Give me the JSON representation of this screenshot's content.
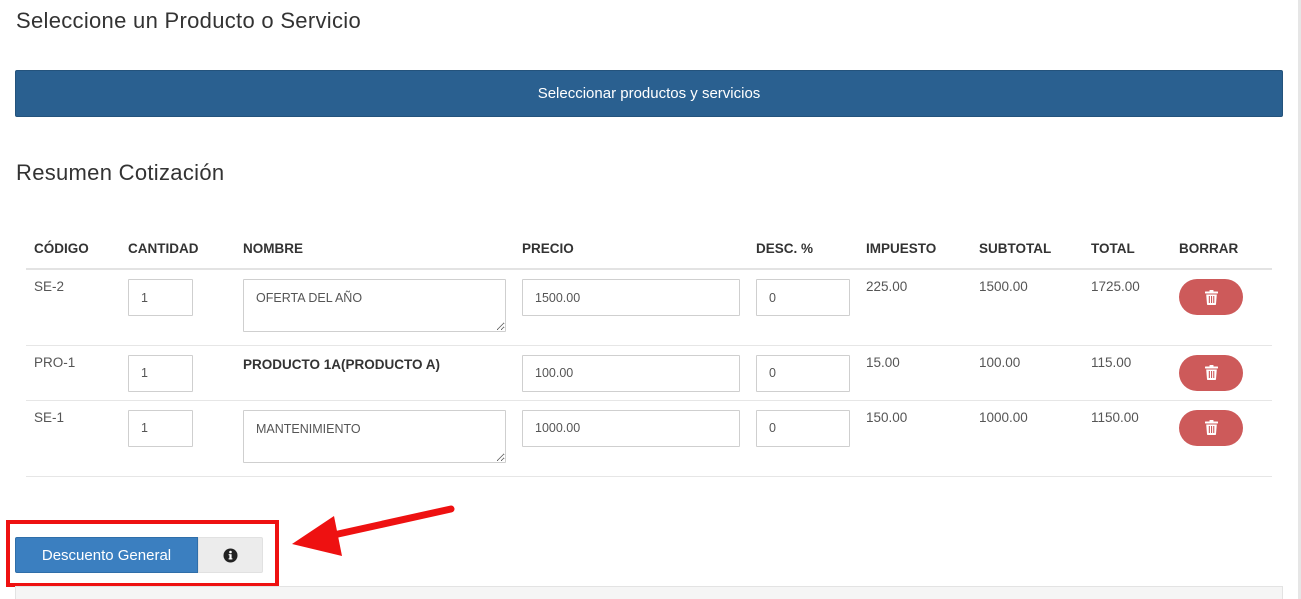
{
  "headings": {
    "select": "Seleccione un Producto o Servicio",
    "summary": "Resumen Cotización"
  },
  "select_button": "Seleccionar productos y servicios",
  "table": {
    "headers": [
      "CÓDIGO",
      "CANTIDAD",
      "NOMBRE",
      "PRECIO",
      "DESC. %",
      "IMPUESTO",
      "SUBTOTAL",
      "TOTAL",
      "BORRAR"
    ],
    "rows": [
      {
        "code": "SE-2",
        "qty": "1",
        "name": "OFERTA DEL AÑO",
        "name_editable": true,
        "price": "1500.00",
        "discount": "0",
        "tax": "225.00",
        "subtotal": "1500.00",
        "total": "1725.00"
      },
      {
        "code": "PRO-1",
        "qty": "1",
        "name": "PRODUCTO 1A(PRODUCTO A)",
        "name_editable": false,
        "price": "100.00",
        "discount": "0",
        "tax": "15.00",
        "subtotal": "100.00",
        "total": "115.00"
      },
      {
        "code": "SE-1",
        "qty": "1",
        "name": "MANTENIMIENTO",
        "name_editable": true,
        "price": "1000.00",
        "discount": "0",
        "tax": "150.00",
        "subtotal": "1000.00",
        "total": "1150.00"
      }
    ]
  },
  "general_discount": {
    "button_label": "Descuento General",
    "info_icon": "info-circle-icon"
  },
  "icons": {
    "delete": "trash-icon",
    "info": "info-circle-icon"
  },
  "colors": {
    "select_button": "#2a6090",
    "discount_button": "#3b7fc0",
    "delete_button": "#cd5a5a",
    "total_text": "#2f3ccf",
    "annotation": "#ee1111"
  }
}
